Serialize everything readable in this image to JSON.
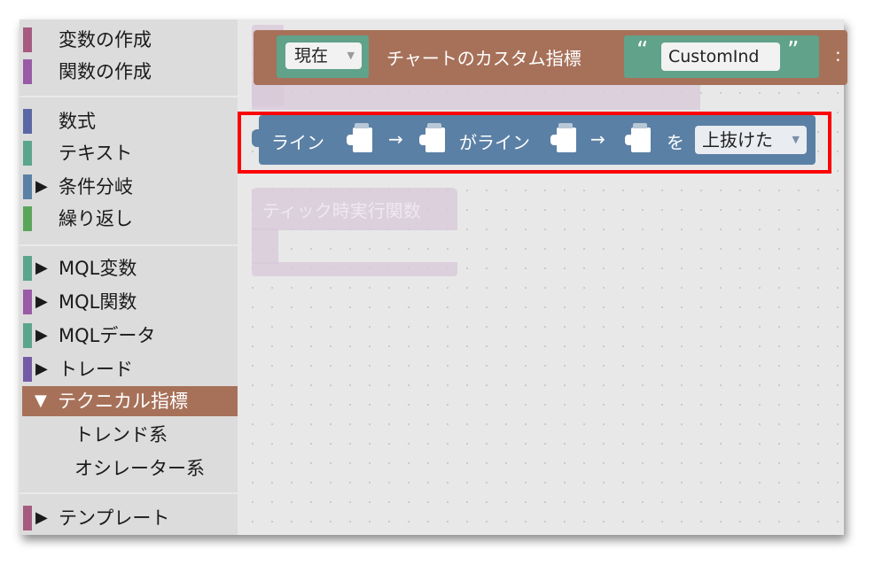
{
  "toolbox": {
    "items": [
      {
        "label": "変数の作成",
        "color": "#a55b80",
        "type": "plain"
      },
      {
        "label": "関数の作成",
        "color": "#995ba5",
        "type": "plain"
      },
      {
        "label": "数式",
        "color": "#5b67a5",
        "type": "plain"
      },
      {
        "label": "テキスト",
        "color": "#5ba58c",
        "type": "plain"
      },
      {
        "label": "条件分岐",
        "color": "#5b80a5",
        "type": "cat",
        "arrow": "▶"
      },
      {
        "label": "繰り返し",
        "color": "#5ba55b",
        "type": "plain"
      },
      {
        "label": "MQL変数",
        "color": "#5ba58c",
        "type": "cat",
        "arrow": "▶"
      },
      {
        "label": "MQL関数",
        "color": "#995ba5",
        "type": "cat",
        "arrow": "▶"
      },
      {
        "label": "MQLデータ",
        "color": "#5ba58c",
        "type": "cat",
        "arrow": "▶"
      },
      {
        "label": "トレード",
        "color": "#745ba5",
        "type": "cat",
        "arrow": "▶"
      },
      {
        "label": "テクニカル指標",
        "color": "#a77159",
        "type": "cat",
        "arrow": "▼",
        "selected": true
      },
      {
        "label": "トレンド系",
        "type": "sub"
      },
      {
        "label": "オシレーター系",
        "type": "sub"
      },
      {
        "label": "テンプレート",
        "color": "#a55b80",
        "type": "cat",
        "arrow": "▶"
      }
    ]
  },
  "workspace": {
    "chart_block": {
      "scope_value": "現在",
      "label": "チャートのカスタム指標",
      "open_quote": "“",
      "name_value": "CustomInd",
      "close_quote": "”",
      "tail": ":",
      "color": "#a77159"
    },
    "line_block": {
      "label_line": "ライン",
      "arrow1": "→",
      "label_ga_line": "がライン",
      "arrow2": "→",
      "label_wo": "を",
      "cross_value": "上抜けた",
      "color": "#5b80a5"
    },
    "ghost_block": {
      "label": "ティック時実行関数"
    }
  },
  "highlight_color": "#ff0000"
}
